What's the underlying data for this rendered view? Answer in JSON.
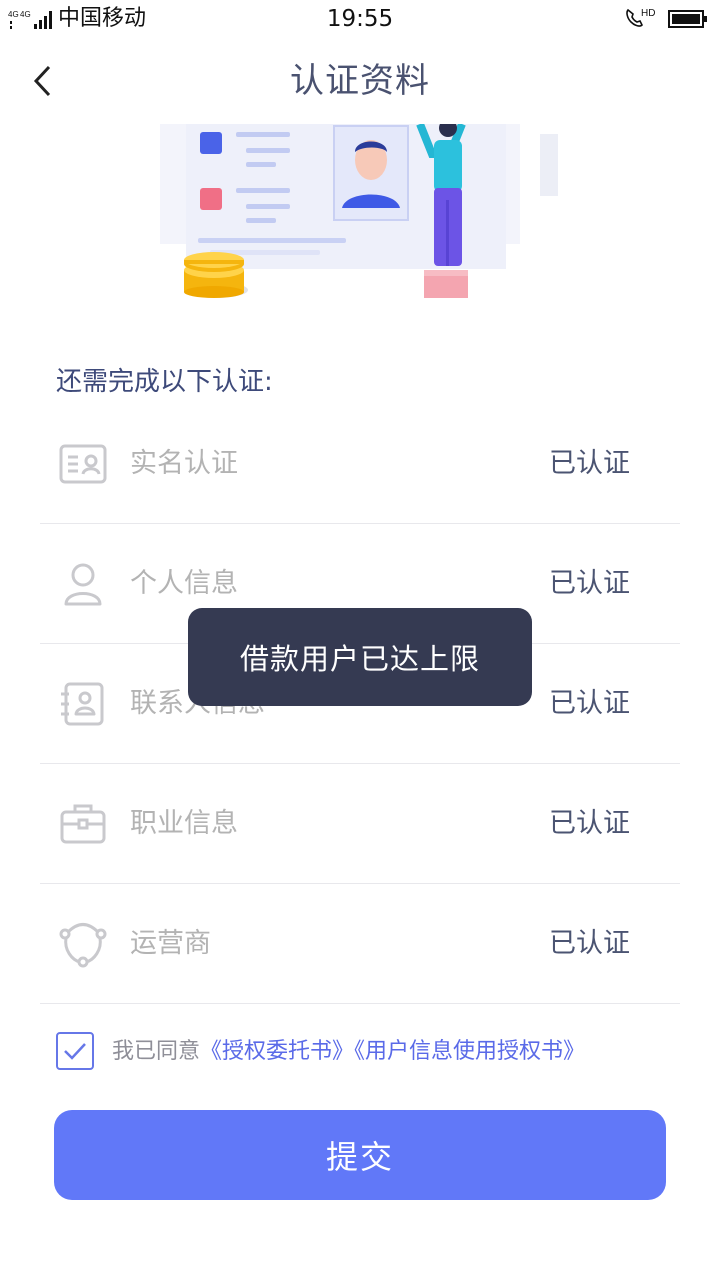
{
  "status_bar": {
    "carrier": "中国移动",
    "time": "19:55",
    "network": "4G 4G",
    "hd": "HD"
  },
  "nav": {
    "title": "认证资料"
  },
  "section": {
    "title": "还需完成以下认证:"
  },
  "items": [
    {
      "label": "实名认证",
      "status": "已认证",
      "icon": "id-card-icon"
    },
    {
      "label": "个人信息",
      "status": "已认证",
      "icon": "person-icon"
    },
    {
      "label": "联系人信息",
      "status": "已认证",
      "icon": "contact-card-icon"
    },
    {
      "label": "职业信息",
      "status": "已认证",
      "icon": "briefcase-icon"
    },
    {
      "label": "运营商",
      "status": "已认证",
      "icon": "operator-icon"
    }
  ],
  "agreement": {
    "checked": true,
    "prefix": "我已同意",
    "link1": "《授权委托书》",
    "link2": "《用户信息使用授权书》"
  },
  "submit": {
    "label": "提交"
  },
  "toast": {
    "message": "借款用户已达上限"
  },
  "colors": {
    "accent": "#6178f8",
    "link": "#5a6ae8",
    "toast_bg": "#353a52",
    "title": "#4a5270"
  }
}
